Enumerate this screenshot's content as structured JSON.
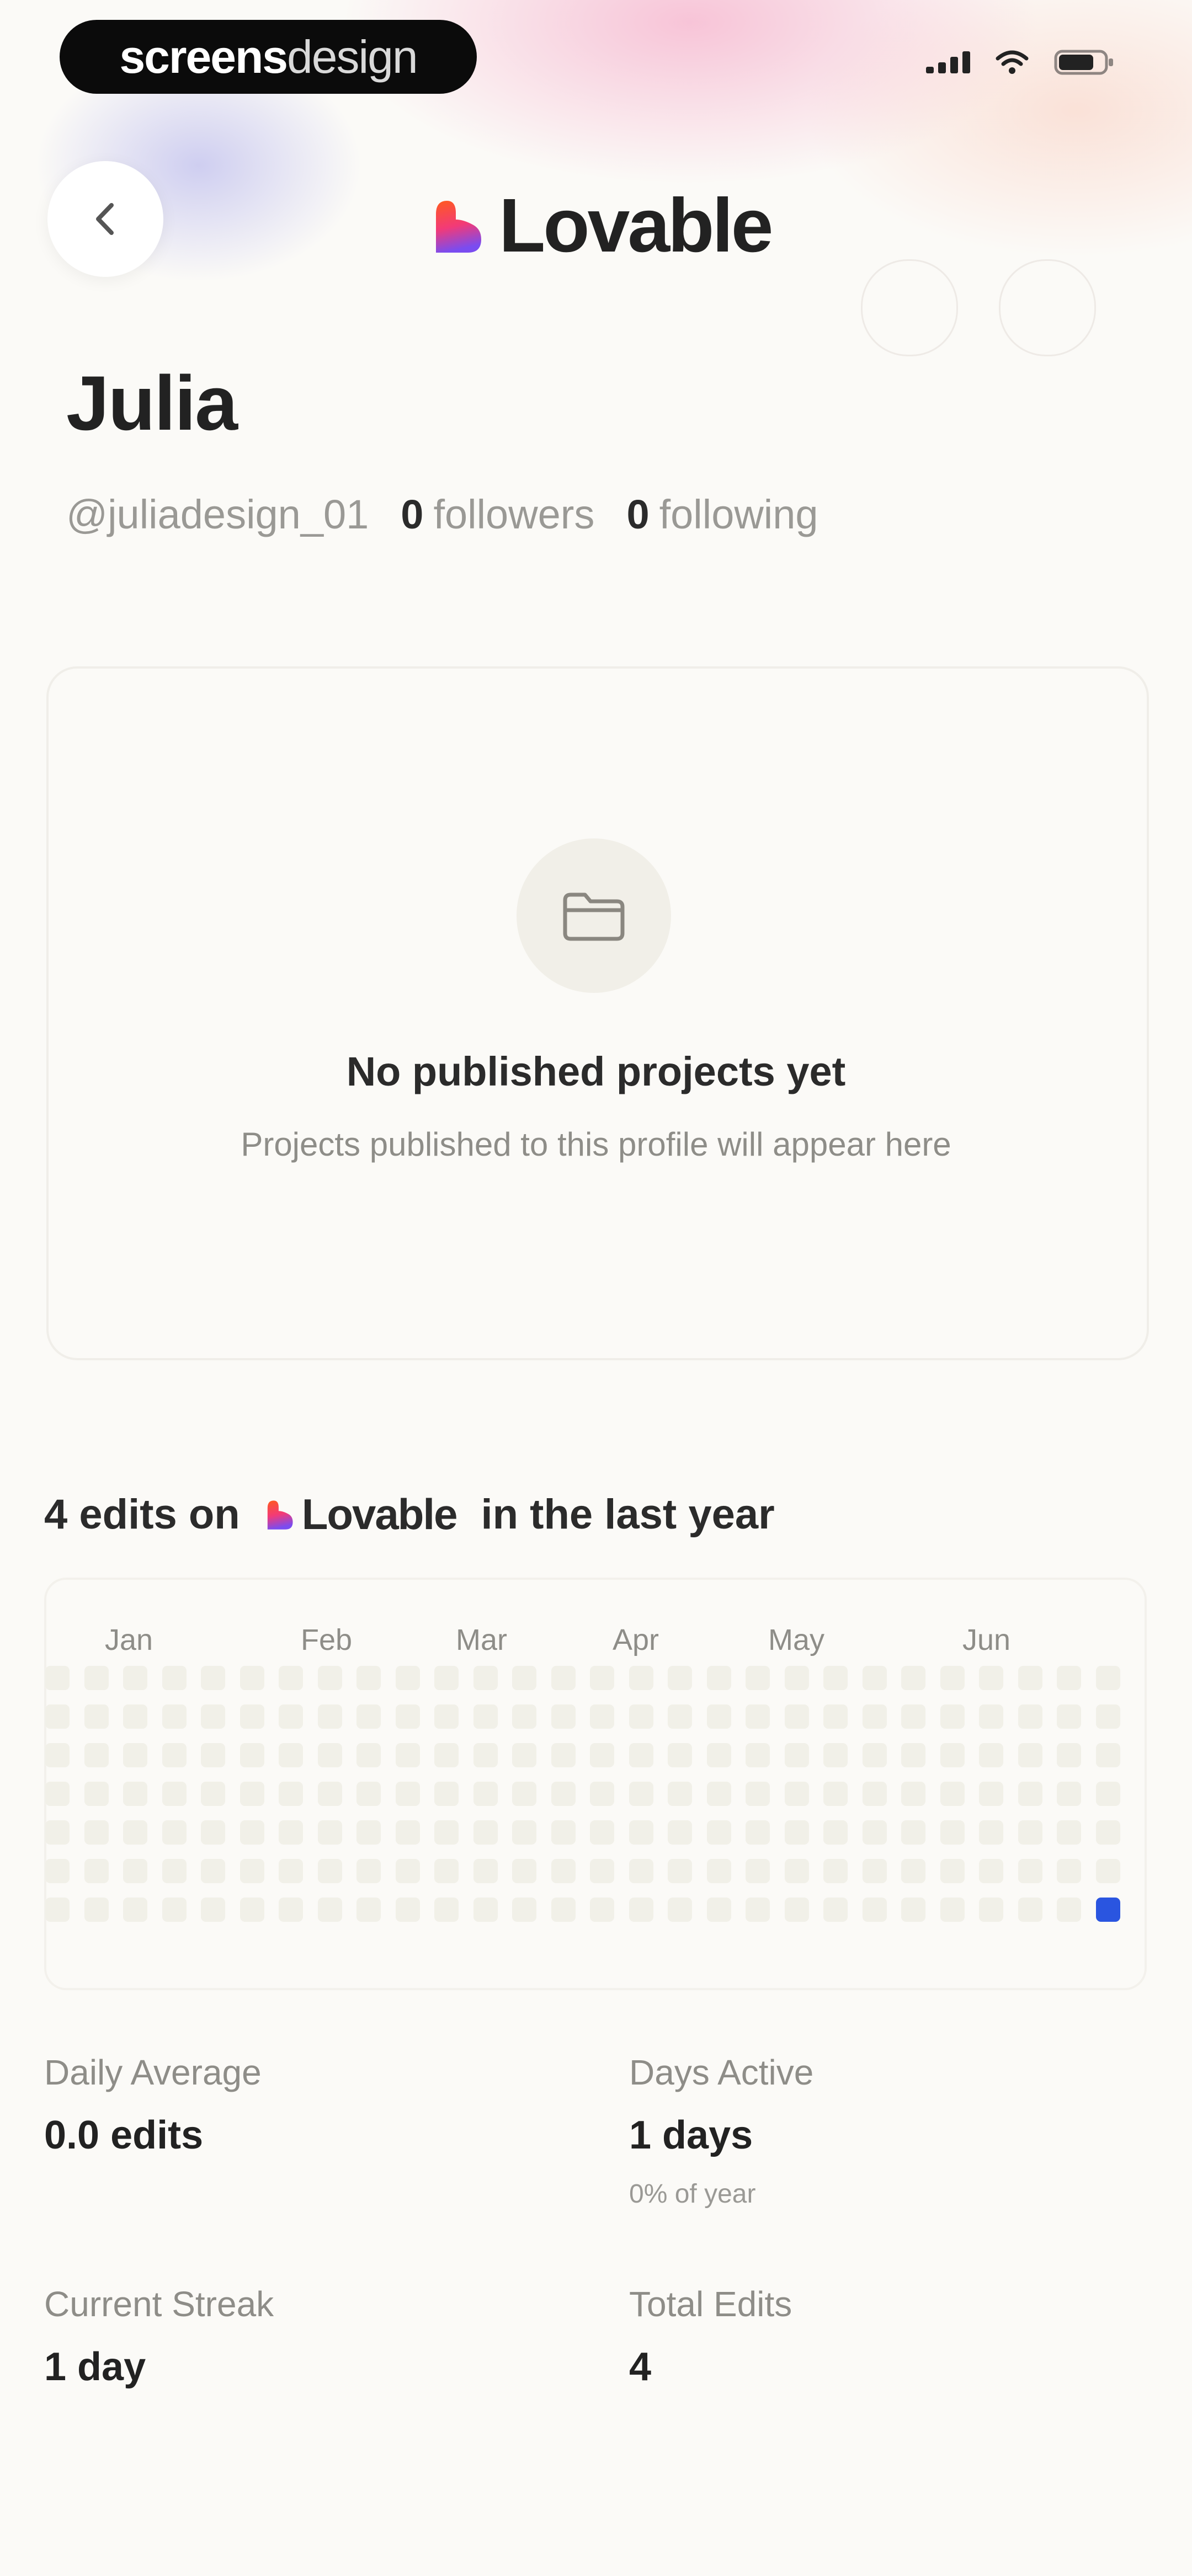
{
  "status_bar": {
    "brand_a": "screens",
    "brand_b": "design"
  },
  "header": {
    "logo_text": "Lovable"
  },
  "profile": {
    "name": "Julia",
    "handle": "@juliadesign_01",
    "followers_count": "0",
    "followers_label": "followers",
    "following_count": "0",
    "following_label": "following"
  },
  "empty_state": {
    "title": "No published projects yet",
    "subtitle": "Projects published to this profile will appear here"
  },
  "activity": {
    "title_prefix": "4 edits on",
    "logo_text": "Lovable",
    "title_suffix": "in the last year",
    "months": [
      "Jan",
      "Feb",
      "Mar",
      "Apr",
      "May",
      "Jun"
    ],
    "weeks": 28,
    "days_per_week": 7,
    "active_cells": [
      {
        "week": 27,
        "day": 6
      }
    ]
  },
  "stats": {
    "daily_average": {
      "label": "Daily Average",
      "value": "0.0 edits"
    },
    "days_active": {
      "label": "Days Active",
      "value": "1 days",
      "sub": "0% of year"
    },
    "current_streak": {
      "label": "Current Streak",
      "value": "1 day"
    },
    "total_edits": {
      "label": "Total Edits",
      "value": "4"
    }
  },
  "colors": {
    "background": "#fbfaf7",
    "heat_active": "#2a55e0",
    "heat_empty": "#f1f0e8"
  }
}
